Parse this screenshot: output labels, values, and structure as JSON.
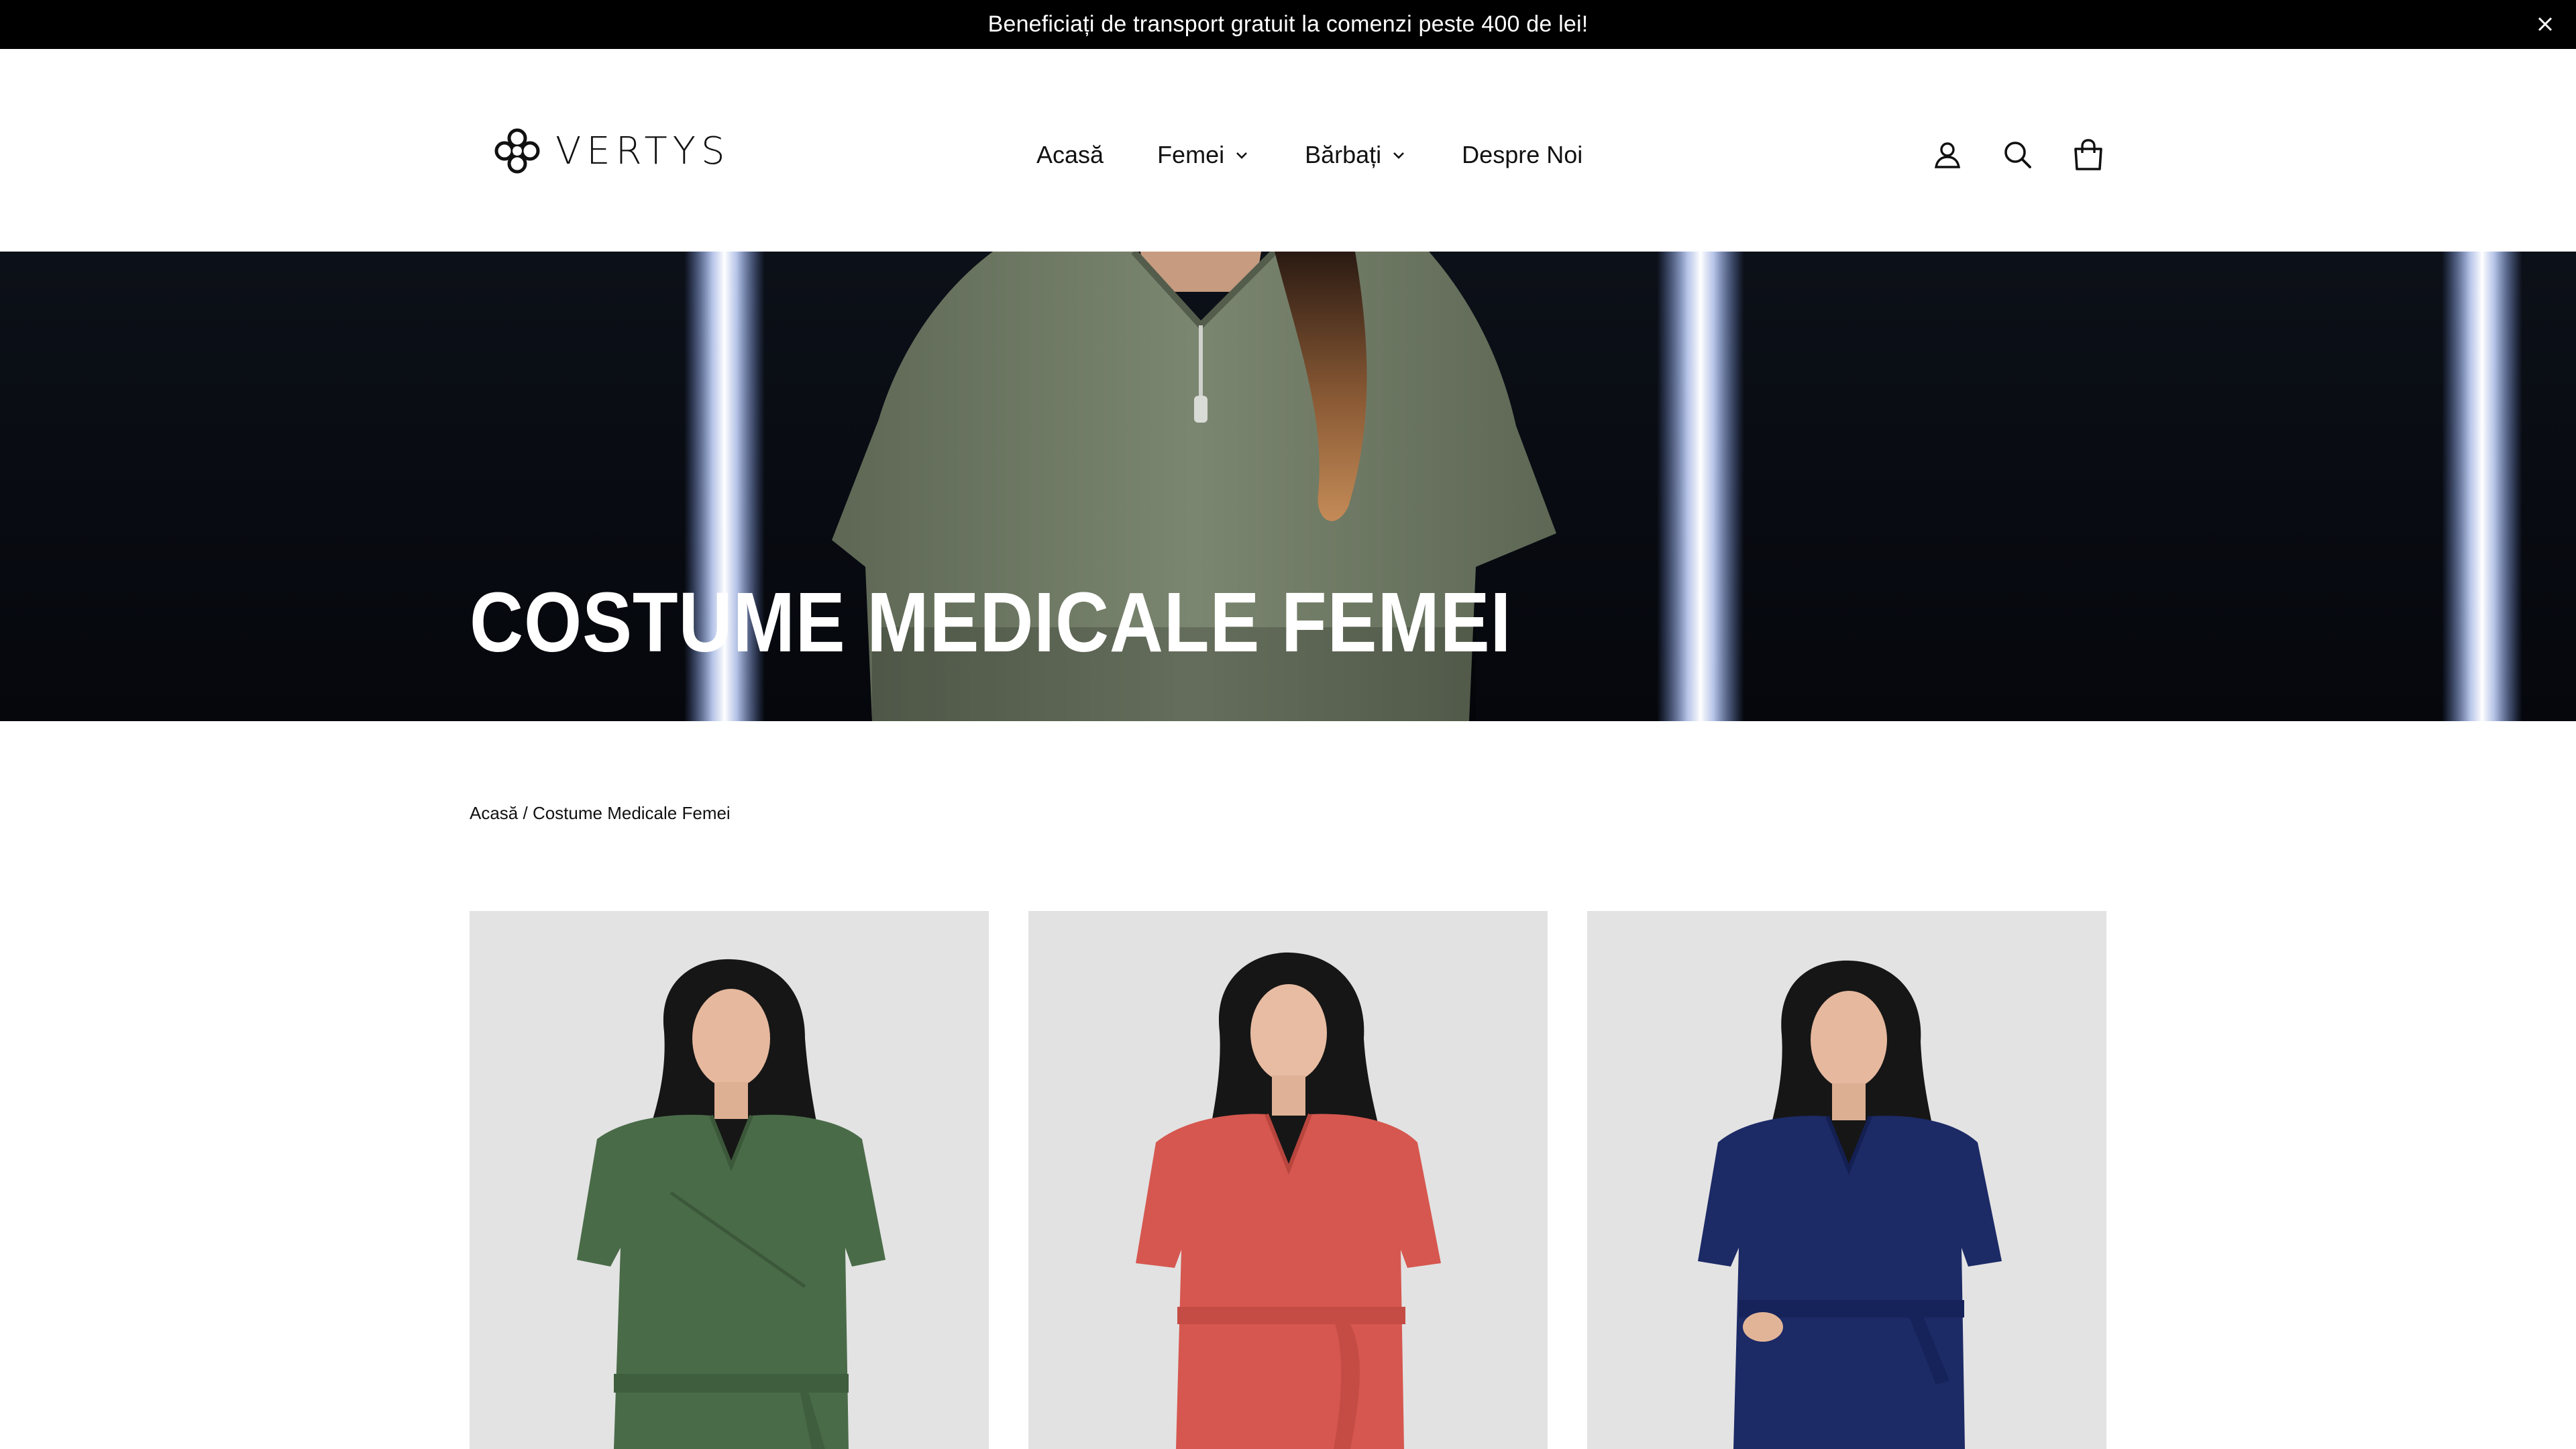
{
  "announcement": {
    "text": "Beneficiați de transport gratuit la comenzi peste 400 de lei!"
  },
  "header": {
    "logo_text": "VERTYS",
    "nav": [
      {
        "label": "Acasă",
        "has_dropdown": false
      },
      {
        "label": "Femei",
        "has_dropdown": true
      },
      {
        "label": "Bărbați",
        "has_dropdown": true
      },
      {
        "label": "Despre Noi",
        "has_dropdown": false
      }
    ],
    "icons": [
      "account-icon",
      "search-icon",
      "cart-icon"
    ]
  },
  "hero": {
    "title": "COSTUME MEDICALE FEMEI"
  },
  "breadcrumb": {
    "home": "Acasă",
    "separator": " / ",
    "current": "Costume Medicale Femei"
  },
  "products": [
    {
      "image": "product-photo",
      "scrub_color": "#4a6b48"
    },
    {
      "image": "product-photo",
      "scrub_color": "#d6574f"
    },
    {
      "image": "product-photo",
      "scrub_color": "#1c2a66"
    }
  ],
  "colors": {
    "announcement_bg": "#000000",
    "hero_bg": "#07090f",
    "hero_scrub": "#6f7a63",
    "text": "#111111",
    "product_bg": "#e2e2e2"
  }
}
